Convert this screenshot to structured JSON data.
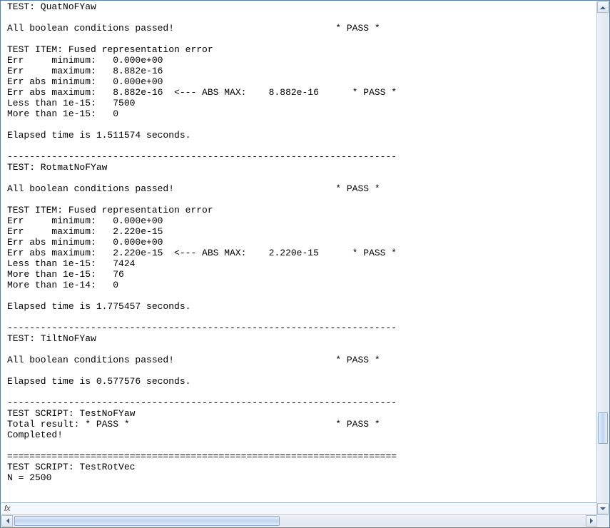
{
  "console_lines": [
    "TEST: QuatNoFYaw",
    "",
    "All boolean conditions passed!                             * PASS *",
    "",
    "TEST ITEM: Fused representation error",
    "Err     minimum:   0.000e+00",
    "Err     maximum:   8.882e-16",
    "Err abs minimum:   0.000e+00",
    "Err abs maximum:   8.882e-16  <--- ABS MAX:    8.882e-16      * PASS *",
    "Less than 1e-15:   7500",
    "More than 1e-15:   0",
    "",
    "Elapsed time is 1.511574 seconds.",
    "",
    "----------------------------------------------------------------------",
    "TEST: RotmatNoFYaw",
    "",
    "All boolean conditions passed!                             * PASS *",
    "",
    "TEST ITEM: Fused representation error",
    "Err     minimum:   0.000e+00",
    "Err     maximum:   2.220e-15",
    "Err abs minimum:   0.000e+00",
    "Err abs maximum:   2.220e-15  <--- ABS MAX:    2.220e-15      * PASS *",
    "Less than 1e-15:   7424",
    "More than 1e-15:   76",
    "More than 1e-14:   0",
    "",
    "Elapsed time is 1.775457 seconds.",
    "",
    "----------------------------------------------------------------------",
    "TEST: TiltNoFYaw",
    "",
    "All boolean conditions passed!                             * PASS *",
    "",
    "Elapsed time is 0.577576 seconds.",
    "",
    "----------------------------------------------------------------------",
    "TEST SCRIPT: TestNoFYaw",
    "Total result: * PASS *                                     * PASS *",
    "Completed!",
    "",
    "======================================================================",
    "TEST SCRIPT: TestRotVec",
    "N = 2500"
  ],
  "fx_label": "fx",
  "tests": {
    "QuatNoFYaw": {
      "boolean_pass": true,
      "items": {
        "Fused representation error": {
          "err_min": "0.000e+00",
          "err_max": "8.882e-16",
          "err_abs_min": "0.000e+00",
          "err_abs_max": "8.882e-16",
          "abs_max_echo": "8.882e-16",
          "pass": true,
          "less_than_1e-15": 7500,
          "more_than_1e-15": 0
        }
      },
      "elapsed_seconds": 1.511574
    },
    "RotmatNoFYaw": {
      "boolean_pass": true,
      "items": {
        "Fused representation error": {
          "err_min": "0.000e+00",
          "err_max": "2.220e-15",
          "err_abs_min": "0.000e+00",
          "err_abs_max": "2.220e-15",
          "abs_max_echo": "2.220e-15",
          "pass": true,
          "less_than_1e-15": 7424,
          "more_than_1e-15": 76,
          "more_than_1e-14": 0
        }
      },
      "elapsed_seconds": 1.775457
    },
    "TiltNoFYaw": {
      "boolean_pass": true,
      "elapsed_seconds": 0.577576
    }
  },
  "scripts": {
    "TestNoFYaw": {
      "total_result": "PASS",
      "completed": true
    },
    "TestRotVec": {
      "N": 2500
    }
  }
}
